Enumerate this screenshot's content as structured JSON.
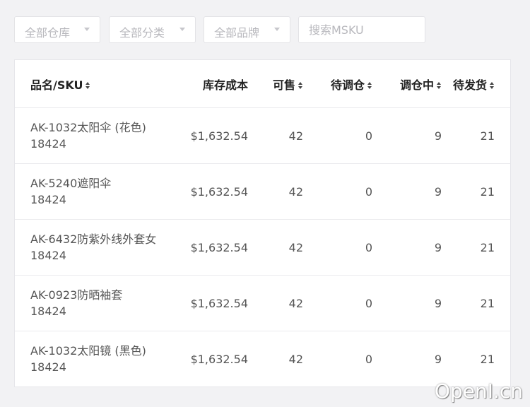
{
  "filters": {
    "warehouse_label": "全部仓库",
    "category_label": "全部分类",
    "brand_label": "全部品牌",
    "search_placeholder": "搜索MSKU"
  },
  "table": {
    "headers": {
      "name": "品名/SKU",
      "cost": "库存成本",
      "sellable": "可售",
      "pending_transfer": "待调仓",
      "transferring": "调仓中",
      "pending_ship": "待发货"
    },
    "rows": [
      {
        "name": "AK-1032太阳伞 (花色)",
        "sku": "18424",
        "cost": "$1,632.54",
        "sellable": "42",
        "pending_transfer": "0",
        "transferring": "9",
        "pending_ship": "21"
      },
      {
        "name": "AK-5240遮阳伞",
        "sku": "18424",
        "cost": "$1,632.54",
        "sellable": "42",
        "pending_transfer": "0",
        "transferring": "9",
        "pending_ship": "21"
      },
      {
        "name": "AK-6432防紫外线外套女",
        "sku": "18424",
        "cost": "$1,632.54",
        "sellable": "42",
        "pending_transfer": "0",
        "transferring": "9",
        "pending_ship": "21"
      },
      {
        "name": "AK-0923防晒袖套",
        "sku": "18424",
        "cost": "$1,632.54",
        "sellable": "42",
        "pending_transfer": "0",
        "transferring": "9",
        "pending_ship": "21"
      },
      {
        "name": "AK-1032太阳镜 (黑色)",
        "sku": "18424",
        "cost": "$1,632.54",
        "sellable": "42",
        "pending_transfer": "0",
        "transferring": "9",
        "pending_ship": "21"
      }
    ]
  },
  "watermark": "OpenI.cn"
}
